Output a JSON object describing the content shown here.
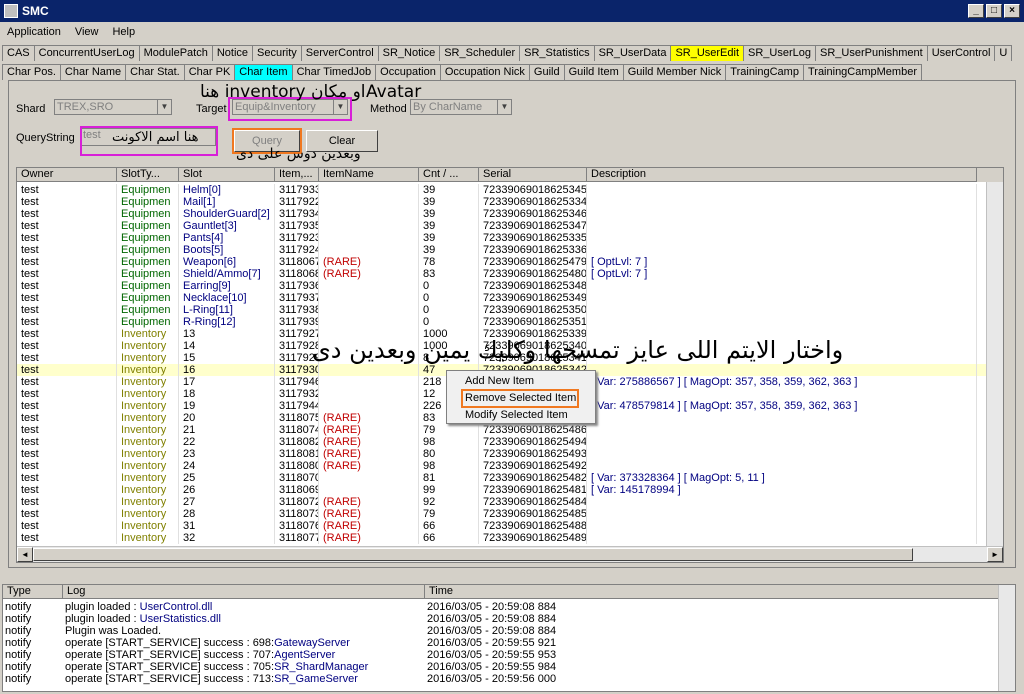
{
  "window": {
    "title": "SMC"
  },
  "menu": [
    "Application",
    "View",
    "Help"
  ],
  "tabs_row1": [
    "CAS",
    "ConcurrentUserLog",
    "ModulePatch",
    "Notice",
    "Security",
    "ServerControl",
    "SR_Notice",
    "SR_Scheduler",
    "SR_Statistics",
    "SR_UserData",
    "SR_UserEdit",
    "SR_UserLog",
    "SR_UserPunishment",
    "UserControl",
    "U"
  ],
  "tabs_row2": [
    "Char Pos.",
    "Char Name",
    "Char Stat.",
    "Char PK",
    "Char Item",
    "Char TimedJob",
    "Occupation",
    "Occupation Nick",
    "Guild",
    "Guild Item",
    "Guild Member Nick",
    "TrainingCamp",
    "TrainingCampMember"
  ],
  "form": {
    "shard_label": "Shard",
    "shard_value": "TREX,SRO",
    "target_label": "Target",
    "target_value": "Equip&Inventory",
    "method_label": "Method",
    "method_value": "By CharName",
    "query_label": "QueryString",
    "query_value": "test",
    "query_button": "Query",
    "clear_button": "Clear"
  },
  "annotations": {
    "target_note": "او مكان inventory هنا",
    "target_note_en": "Avatar",
    "account_note": "هنا اسم الاكونت",
    "query_note": "وبعدين دوس على دى",
    "select_note": "واختار الايتم اللى عايز تمسحها وكليك يمين وبعدين دى"
  },
  "grid": {
    "columns": [
      "Owner",
      "SlotTy...",
      "Slot",
      "Item,...",
      "ItemName",
      "Cnt / ...",
      "Serial",
      "Description"
    ],
    "rows": [
      [
        "test",
        "Equipmen",
        "Helm[0]",
        "3117933",
        "",
        "39",
        "72339069018625345",
        ""
      ],
      [
        "test",
        "Equipmen",
        "Mail[1]",
        "3117922",
        "",
        "39",
        "72339069018625334",
        ""
      ],
      [
        "test",
        "Equipmen",
        "ShoulderGuard[2]",
        "3117934",
        "",
        "39",
        "72339069018625346",
        ""
      ],
      [
        "test",
        "Equipmen",
        "Gauntlet[3]",
        "3117935",
        "",
        "39",
        "72339069018625347",
        ""
      ],
      [
        "test",
        "Equipmen",
        "Pants[4]",
        "3117923",
        "",
        "39",
        "72339069018625335",
        ""
      ],
      [
        "test",
        "Equipmen",
        "Boots[5]",
        "3117924",
        "",
        "39",
        "72339069018625336",
        ""
      ],
      [
        "test",
        "Equipmen",
        "Weapon[6]",
        "3118067",
        "(RARE)",
        "78",
        "72339069018625479",
        "[ OptLvl: 7 ]"
      ],
      [
        "test",
        "Equipmen",
        "Shield/Ammo[7]",
        "3118068",
        "(RARE)",
        "83",
        "72339069018625480",
        "[ OptLvl: 7 ]"
      ],
      [
        "test",
        "Equipmen",
        "Earring[9]",
        "3117936",
        "",
        "0",
        "72339069018625348",
        ""
      ],
      [
        "test",
        "Equipmen",
        "Necklace[10]",
        "3117937",
        "",
        "0",
        "72339069018625349",
        ""
      ],
      [
        "test",
        "Equipmen",
        "L-Ring[11]",
        "3117938",
        "",
        "0",
        "72339069018625350",
        ""
      ],
      [
        "test",
        "Equipmen",
        "R-Ring[12]",
        "3117939",
        "",
        "0",
        "72339069018625351",
        ""
      ],
      [
        "test",
        "Inventory",
        "13",
        "3117927",
        "",
        "1000",
        "72339069018625339",
        ""
      ],
      [
        "test",
        "Inventory",
        "14",
        "3117928",
        "",
        "1000",
        "72339069018625340",
        ""
      ],
      [
        "test",
        "Inventory",
        "15",
        "3117929",
        "",
        "8",
        "72339069018625341",
        ""
      ],
      [
        "test",
        "Inventory",
        "16",
        "3117930",
        "",
        "47",
        "72339069018625342",
        ""
      ],
      [
        "test",
        "Inventory",
        "17",
        "3117946",
        "",
        "218",
        "72339069018625358",
        "[ Var: 275886567 ] [ MagOpt: 357, 358, 359, 362, 363 ]"
      ],
      [
        "test",
        "Inventory",
        "18",
        "3117932",
        "",
        "12",
        "72339069018625344",
        ""
      ],
      [
        "test",
        "Inventory",
        "19",
        "3117944",
        "",
        "226",
        "72339069018625356",
        "[ Var: 478579814 ] [ MagOpt: 357, 358, 359, 362, 363 ]"
      ],
      [
        "test",
        "Inventory",
        "20",
        "3118075",
        "(RARE)",
        "83",
        "72339069018625487",
        ""
      ],
      [
        "test",
        "Inventory",
        "21",
        "3118074",
        "(RARE)",
        "79",
        "72339069018625486",
        ""
      ],
      [
        "test",
        "Inventory",
        "22",
        "3118082",
        "(RARE)",
        "98",
        "72339069018625494",
        ""
      ],
      [
        "test",
        "Inventory",
        "23",
        "3118081",
        "(RARE)",
        "80",
        "72339069018625493",
        ""
      ],
      [
        "test",
        "Inventory",
        "24",
        "3118080",
        "(RARE)",
        "98",
        "72339069018625492",
        ""
      ],
      [
        "test",
        "Inventory",
        "25",
        "3118070",
        "",
        "81",
        "72339069018625482",
        "[ Var: 373328364 ] [ MagOpt: 5, 11 ]"
      ],
      [
        "test",
        "Inventory",
        "26",
        "3118069",
        "",
        "99",
        "72339069018625481",
        "[ Var: 145178994 ]"
      ],
      [
        "test",
        "Inventory",
        "27",
        "3118072",
        "(RARE)",
        "92",
        "72339069018625484",
        ""
      ],
      [
        "test",
        "Inventory",
        "28",
        "3118073",
        "(RARE)",
        "79",
        "72339069018625485",
        ""
      ],
      [
        "test",
        "Inventory",
        "31",
        "3118076",
        "(RARE)",
        "66",
        "72339069018625488",
        ""
      ],
      [
        "test",
        "Inventory",
        "32",
        "3118077",
        "(RARE)",
        "66",
        "72339069018625489",
        ""
      ]
    ]
  },
  "context_menu": [
    "Add New Item",
    "Remove Selected Item",
    "Modify Selected Item"
  ],
  "log": {
    "columns": [
      "Type",
      "Log",
      "Time"
    ],
    "rows": [
      [
        "notify",
        "plugin loaded : ",
        "UserControl.dll",
        "2016/03/05 - 20:59:08 884"
      ],
      [
        "notify",
        "plugin loaded : ",
        "UserStatistics.dll",
        "2016/03/05 - 20:59:08 884"
      ],
      [
        "notify",
        "Plugin was Loaded.",
        "",
        "2016/03/05 - 20:59:08 884"
      ],
      [
        "notify",
        "operate [START_SERVICE] success : 698:",
        "GatewayServer",
        "2016/03/05 - 20:59:55 921"
      ],
      [
        "notify",
        "operate [START_SERVICE] success : 707:",
        "AgentServer",
        "2016/03/05 - 20:59:55 953"
      ],
      [
        "notify",
        "operate [START_SERVICE] success : 705:",
        "SR_ShardManager",
        "2016/03/05 - 20:59:55 984"
      ],
      [
        "notify",
        "operate [START_SERVICE] success : 713:",
        "SR_GameServer",
        "2016/03/05 - 20:59:56 000"
      ]
    ]
  }
}
